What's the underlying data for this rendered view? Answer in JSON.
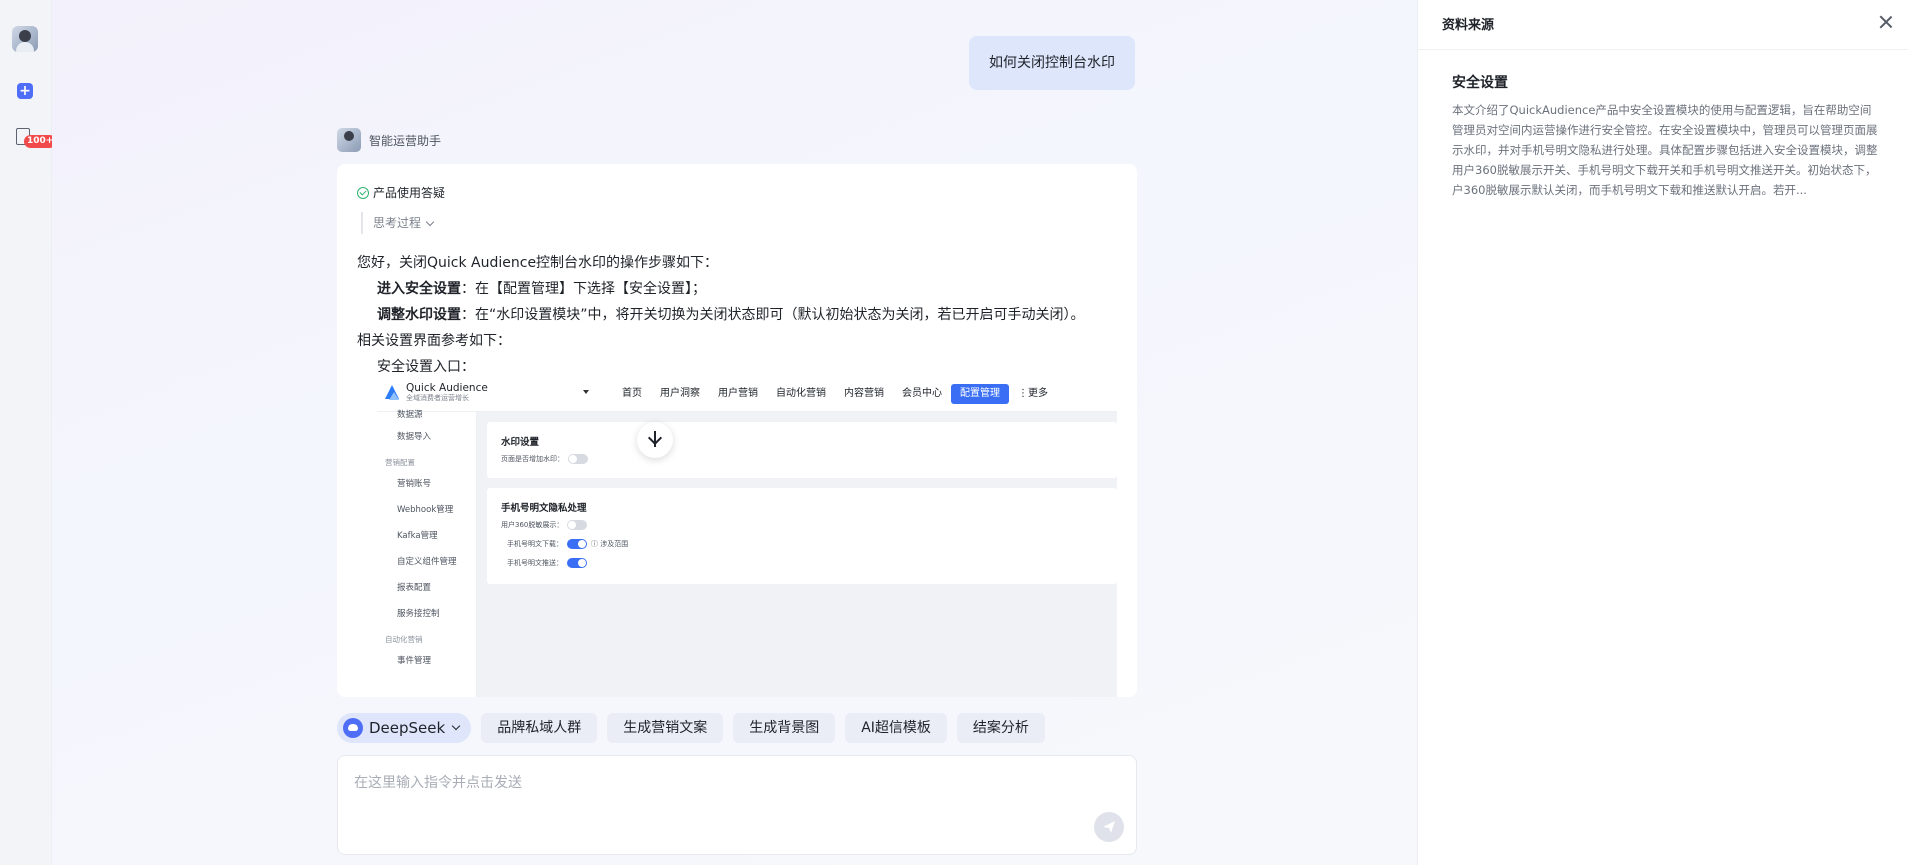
{
  "rail": {
    "badge": "100+"
  },
  "chat": {
    "user_message": "如何关闭控制台水印",
    "assistant_name": "智能运营助手",
    "tag": "产品使用答疑",
    "thinking_label": "思考过程",
    "answer": {
      "intro": "您好，关闭Quick Audience控制台水印的操作步骤如下：",
      "step1_label": "进入安全设置",
      "step1_text": "：在【配置管理】下选择【安全设置】；",
      "step2_label": "调整水印设置",
      "step2_text": "：在“水印设置模块”中，将开关切换为关闭状态即可（默认初始状态为关闭，若已开启可手动关闭）。",
      "ref_line": "相关设置界面参考如下：",
      "entry_line": "安全设置入口："
    }
  },
  "screenshot": {
    "brand": "Quick Audience",
    "brand_sub": "全域消费者运营增长",
    "nav": [
      "首页",
      "用户洞察",
      "用户营销",
      "自动化营销",
      "内容营销",
      "会员中心",
      "配置管理",
      "⋮更多"
    ],
    "nav_active": "配置管理",
    "sidebar": {
      "item_top": "数据源",
      "item_import": "数据导入",
      "group_marketing": "营销配置",
      "item_account": "营销账号",
      "item_webhook": "Webhook管理",
      "item_kafka": "Kafka管理",
      "item_custom": "自定义组件管理",
      "item_report": "报表配置",
      "item_service": "服务接控制",
      "group_auto": "自动化营销",
      "item_event": "事件管理"
    },
    "watermark_title": "水印设置",
    "watermark_row": "页面是否增加水印：",
    "privacy_title": "手机号明文隐私处理",
    "privacy_row1": "用户360脱敏展示：",
    "privacy_row2": "手机号明文下载：",
    "privacy_row2_extra": "ⓘ 涉及范围",
    "privacy_row3": "手机号明文推送："
  },
  "chips": {
    "model": "DeepSeek",
    "items": [
      "品牌私域人群",
      "生成营销文案",
      "生成背景图",
      "AI超信模板",
      "结案分析"
    ]
  },
  "input": {
    "placeholder": "在这里输入指令并点击发送"
  },
  "side_panel": {
    "title": "资料来源",
    "source_title": "安全设置",
    "source_text": "本文介绍了QuickAudience产品中安全设置模块的使用与配置逻辑，旨在帮助空间管理员对空间内运营操作进行安全管控。在安全设置模块中，管理员可以管理页面展示水印，并对手机号明文隐私进行处理。具体配置步骤包括进入安全设置模块，调整用户360脱敏展示开关、手机号明文下载开关和手机号明文推送开关。初始状态下，户360脱敏展示默认关闭，而手机号明文下载和推送默认开启。若开..."
  },
  "colors": {
    "accent": "#3a6ff5",
    "user_bubble": "#dde6fb",
    "badge": "#f24a4a"
  }
}
